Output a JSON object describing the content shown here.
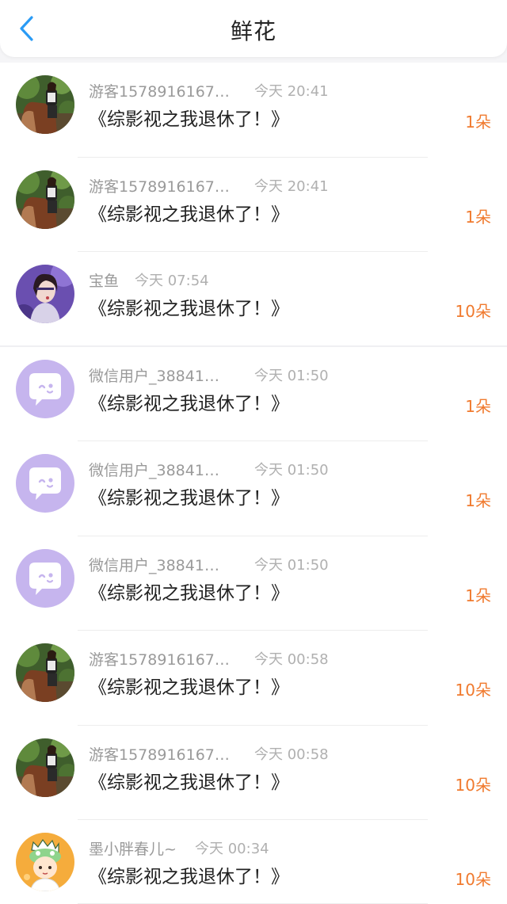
{
  "header": {
    "title": "鲜花",
    "back_icon": "chevron-left-icon",
    "accent_color": "#2a9bf5"
  },
  "colors": {
    "count": "#f07a2e",
    "meta": "#9a9a9a",
    "text": "#222222"
  },
  "rows": [
    {
      "user": "游客1578916167…",
      "time": "今天 20:41",
      "book": "《综影视之我退休了！》",
      "count": "1朵",
      "avatar": "photo-horse-rider"
    },
    {
      "user": "游客1578916167…",
      "time": "今天 20:41",
      "book": "《综影视之我退休了！》",
      "count": "1朵",
      "avatar": "photo-horse-rider"
    },
    {
      "user": "宝鱼",
      "time": "今天 07:54",
      "book": "《综影视之我退休了！》",
      "count": "10朵",
      "avatar": "photo-girl-portrait"
    },
    {
      "user": "微信用户_38841…",
      "time": "今天 01:50",
      "book": "《综影视之我退休了！》",
      "count": "1朵",
      "avatar": "default-chat-avatar"
    },
    {
      "user": "微信用户_38841…",
      "time": "今天 01:50",
      "book": "《综影视之我退休了！》",
      "count": "1朵",
      "avatar": "default-chat-avatar"
    },
    {
      "user": "微信用户_38841…",
      "time": "今天 01:50",
      "book": "《综影视之我退休了！》",
      "count": "1朵",
      "avatar": "default-chat-avatar"
    },
    {
      "user": "游客1578916167…",
      "time": "今天 00:58",
      "book": "《综影视之我退休了！》",
      "count": "10朵",
      "avatar": "photo-horse-rider"
    },
    {
      "user": "游客1578916167…",
      "time": "今天 00:58",
      "book": "《综影视之我退休了！》",
      "count": "10朵",
      "avatar": "photo-horse-rider"
    },
    {
      "user": "墨小胖春儿~",
      "time": "今天 00:34",
      "book": "《综影视之我退休了！》",
      "count": "10朵",
      "avatar": "cartoon-avatar"
    }
  ]
}
